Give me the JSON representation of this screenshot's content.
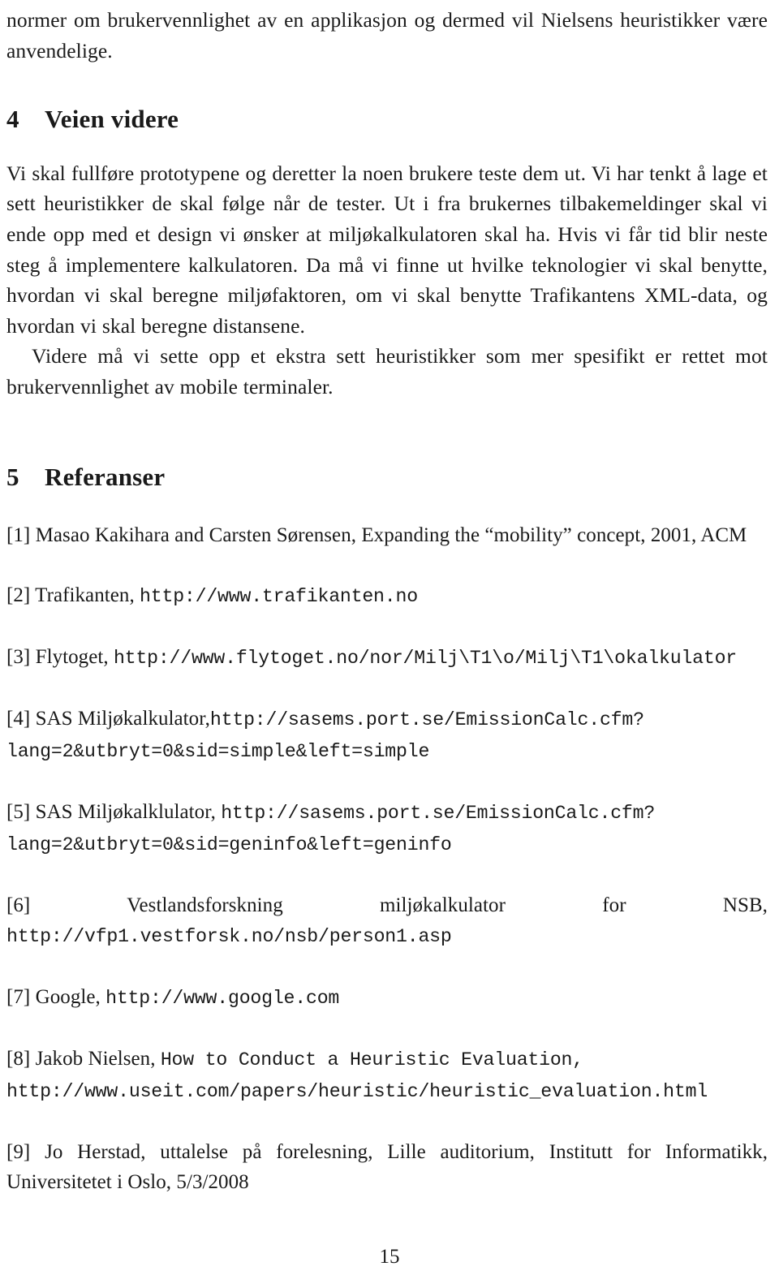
{
  "document": {
    "page_number": "15",
    "continued_paragraph": "normer om brukervennlighet av en applikasjon og dermed vil Nielsens heuristikker være anvendelige."
  },
  "sections": [
    {
      "number": "4",
      "title": "Veien videre",
      "paragraphs": [
        "Vi skal fullføre prototypene og deretter la noen brukere teste dem ut. Vi har tenkt å lage et sett heuristikker de skal følge når de tester. Ut i fra brukernes tilbakemeldinger skal vi ende opp med et design vi ønsker at miljøkalkulatoren skal ha. Hvis vi får tid blir neste steg å implementere kalkulatoren. Da må vi finne ut hvilke teknologier vi skal benytte, hvordan vi skal beregne miljøfaktoren, om vi skal benytte Trafikantens XML-data, og hvordan vi skal beregne distansene.",
        "Videre må vi sette opp et ekstra sett heuristikker som mer spesifikt er rettet mot brukervennlighet av mobile terminaler."
      ]
    },
    {
      "number": "5",
      "title": "Referanser"
    }
  ],
  "references": [
    {
      "label": "[1]",
      "text": "Masao Kakihara and Carsten Sørensen, Expanding the “mobility” concept, 2001, ACM",
      "url": ""
    },
    {
      "label": "[2]",
      "text": "Trafikanten, ",
      "url": "http://www.trafikanten.no"
    },
    {
      "label": "[3]",
      "text": "Flytoget, ",
      "url": "http://www.flytoget.no/nor/Milj\\T1\\o/Milj\\T1\\okalkulator"
    },
    {
      "label": "[4]",
      "text": "SAS Miljøkalkulator,",
      "url": "http://sasems.port.se/EmissionCalc.cfm?lang=2&utbryt=0&sid=simple&left=simple"
    },
    {
      "label": "[5]",
      "text": "SAS Miljøkalklulator, ",
      "url": "http://sasems.port.se/EmissionCalc.cfm?lang=2&utbryt=0&sid=geninfo&left=geninfo"
    },
    {
      "label": "[6]",
      "text": "Vestlandsforskning miljøkalkulator for NSB, ",
      "url": "http://vfp1.vestforsk.no/nsb/person1.asp"
    },
    {
      "label": "[7]",
      "text": "Google, ",
      "url": "http://www.google.com"
    },
    {
      "label": "[8]",
      "text": "Jakob Nielsen, ",
      "title_mono": "How to Conduct a Heuristic Evaluation,",
      "url": "http://www.useit.com/papers/heuristic/heuristic_evaluation.html"
    },
    {
      "label": "[9]",
      "text": "Jo Herstad, uttalelse på forelesning, Lille auditorium, Institutt for Informatikk, Universitetet i Oslo, 5/3/2008",
      "url": ""
    }
  ]
}
